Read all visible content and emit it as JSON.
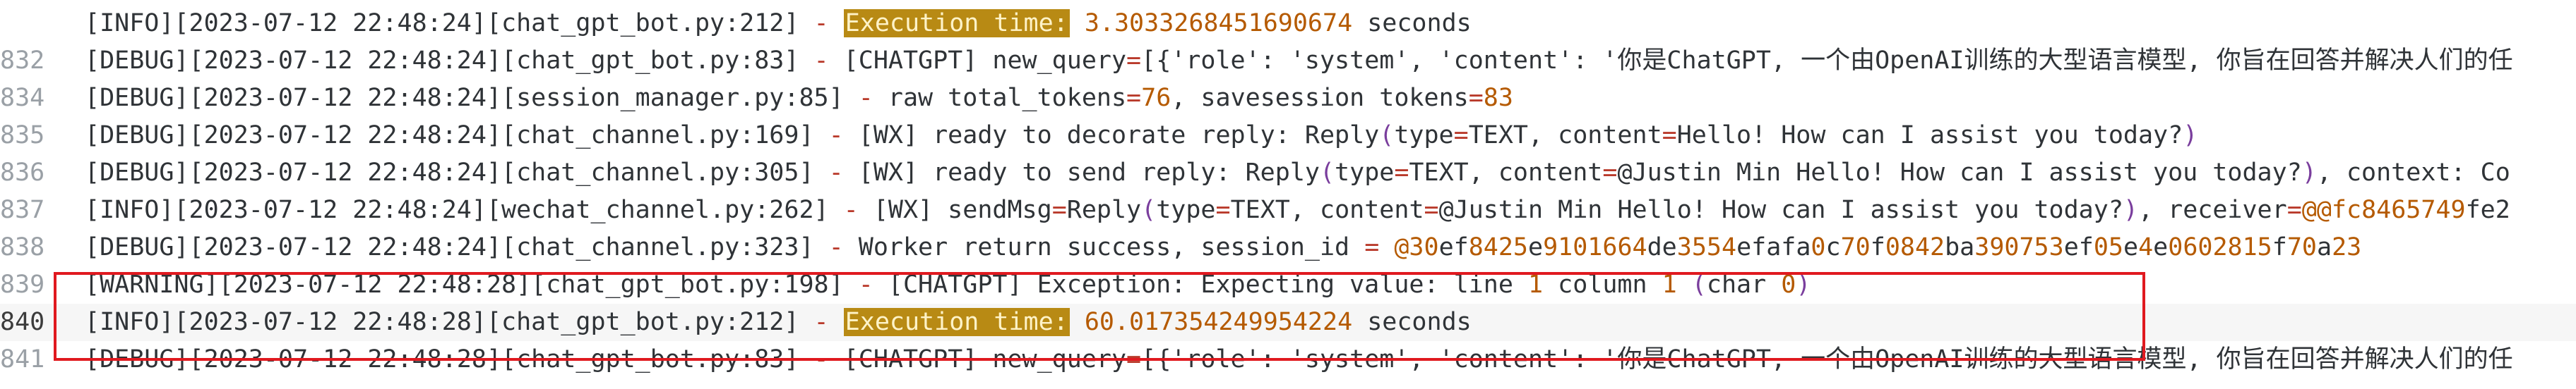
{
  "colors": {
    "background": "#ffffff",
    "text": "#2f3337",
    "line_number": "#9aa0a6",
    "dash": "#b93a2b",
    "number": "#b55a00",
    "highlight_bg": "#b88a14",
    "highlight_fg": "#fff3c8",
    "selection_box": "#e0191f"
  },
  "lines": [
    {
      "num": "",
      "active": false,
      "parts": [
        {
          "t": "[INFO][2023-07-12 22:48:24][chat_gpt_bot.py:212] "
        },
        {
          "t": "-",
          "c": "dash"
        },
        {
          "t": " "
        },
        {
          "t": "Execution time:",
          "c": "hl"
        },
        {
          "t": " "
        },
        {
          "t": "3.3033268451690674",
          "c": "num"
        },
        {
          "t": " seconds"
        }
      ]
    },
    {
      "num": "832",
      "active": false,
      "parts": [
        {
          "t": "[DEBUG][2023-07-12 22:48:24][chat_gpt_bot.py:83] "
        },
        {
          "t": "-",
          "c": "dash"
        },
        {
          "t": " [CHATGPT] new_query"
        },
        {
          "t": "=",
          "c": "eq"
        },
        {
          "t": "[{'role': 'system', 'content': '你是ChatGPT, 一个由OpenAI训练的大型语言模型, 你旨在回答并解决人们的任"
        }
      ]
    },
    {
      "num": "834",
      "active": false,
      "parts": [
        {
          "t": "[DEBUG][2023-07-12 22:48:24][session_manager.py:85] "
        },
        {
          "t": "-",
          "c": "dash"
        },
        {
          "t": " raw total_tokens"
        },
        {
          "t": "=",
          "c": "eq"
        },
        {
          "t": "76",
          "c": "num"
        },
        {
          "t": ", savesession tokens"
        },
        {
          "t": "=",
          "c": "eq"
        },
        {
          "t": "83",
          "c": "num"
        }
      ]
    },
    {
      "num": "835",
      "active": false,
      "parts": [
        {
          "t": "[DEBUG][2023-07-12 22:48:24][chat_channel.py:169] "
        },
        {
          "t": "-",
          "c": "dash"
        },
        {
          "t": " [WX] ready to decorate reply: Reply"
        },
        {
          "t": "(",
          "c": "paren"
        },
        {
          "t": "type"
        },
        {
          "t": "=",
          "c": "eq"
        },
        {
          "t": "TEXT, content"
        },
        {
          "t": "=",
          "c": "eq"
        },
        {
          "t": "Hello! How can I assist you today?"
        },
        {
          "t": ")",
          "c": "paren"
        }
      ]
    },
    {
      "num": "836",
      "active": false,
      "parts": [
        {
          "t": "[DEBUG][2023-07-12 22:48:24][chat_channel.py:305] "
        },
        {
          "t": "-",
          "c": "dash"
        },
        {
          "t": " [WX] ready to send reply: Reply"
        },
        {
          "t": "(",
          "c": "paren"
        },
        {
          "t": "type"
        },
        {
          "t": "=",
          "c": "eq"
        },
        {
          "t": "TEXT, content"
        },
        {
          "t": "=",
          "c": "eq"
        },
        {
          "t": "@Justin Min Hello! How can I assist you today?"
        },
        {
          "t": ")",
          "c": "paren"
        },
        {
          "t": ", context: Co"
        }
      ]
    },
    {
      "num": "837",
      "active": false,
      "parts": [
        {
          "t": "[INFO][2023-07-12 22:48:24][wechat_channel.py:262] "
        },
        {
          "t": "-",
          "c": "dash"
        },
        {
          "t": " [WX] sendMsg"
        },
        {
          "t": "=",
          "c": "eq"
        },
        {
          "t": "Reply"
        },
        {
          "t": "(",
          "c": "paren"
        },
        {
          "t": "type"
        },
        {
          "t": "=",
          "c": "eq"
        },
        {
          "t": "TEXT, content"
        },
        {
          "t": "=",
          "c": "eq"
        },
        {
          "t": "@Justin Min Hello! How can I assist you today?"
        },
        {
          "t": ")",
          "c": "paren"
        },
        {
          "t": ", receiver"
        },
        {
          "t": "=",
          "c": "eq"
        },
        {
          "t": "@@fc",
          "c": "num"
        },
        {
          "t": "8465749",
          "c": "num"
        },
        {
          "t": "fe2"
        }
      ]
    },
    {
      "num": "838",
      "active": false,
      "parts": [
        {
          "t": "[DEBUG][2023-07-12 22:48:24][chat_channel.py:323] "
        },
        {
          "t": "-",
          "c": "dash"
        },
        {
          "t": " Worker return success, session_id "
        },
        {
          "t": "=",
          "c": "eq"
        },
        {
          "t": " "
        },
        {
          "t": "@30",
          "c": "num"
        },
        {
          "t": "ef"
        },
        {
          "t": "8425",
          "c": "num"
        },
        {
          "t": "e"
        },
        {
          "t": "9101664",
          "c": "num"
        },
        {
          "t": "de"
        },
        {
          "t": "3554",
          "c": "num"
        },
        {
          "t": "efafa"
        },
        {
          "t": "0",
          "c": "num"
        },
        {
          "t": "c"
        },
        {
          "t": "70",
          "c": "num"
        },
        {
          "t": "f"
        },
        {
          "t": "0842",
          "c": "num"
        },
        {
          "t": "ba"
        },
        {
          "t": "390753",
          "c": "num"
        },
        {
          "t": "ef"
        },
        {
          "t": "05",
          "c": "num"
        },
        {
          "t": "e"
        },
        {
          "t": "4",
          "c": "num"
        },
        {
          "t": "e"
        },
        {
          "t": "0602815",
          "c": "num"
        },
        {
          "t": "f"
        },
        {
          "t": "70",
          "c": "num"
        },
        {
          "t": "a"
        },
        {
          "t": "23",
          "c": "num"
        }
      ]
    },
    {
      "num": "839",
      "active": false,
      "parts": [
        {
          "t": "[WARNING][2023-07-12 22:48:28][chat_gpt_bot.py:198] "
        },
        {
          "t": "-",
          "c": "dash"
        },
        {
          "t": " [CHATGPT] Exception: Expecting value: line "
        },
        {
          "t": "1",
          "c": "num"
        },
        {
          "t": " column "
        },
        {
          "t": "1",
          "c": "num"
        },
        {
          "t": " "
        },
        {
          "t": "(",
          "c": "paren"
        },
        {
          "t": "char "
        },
        {
          "t": "0",
          "c": "num"
        },
        {
          "t": ")",
          "c": "paren"
        }
      ]
    },
    {
      "num": "840",
      "active": true,
      "parts": [
        {
          "t": "[INFO][2023-07-12 22:48:28][chat_gpt_bot.py:212] "
        },
        {
          "t": "-",
          "c": "dash"
        },
        {
          "t": " "
        },
        {
          "t": "Execution time:",
          "c": "hl"
        },
        {
          "t": " "
        },
        {
          "t": "60.017354249954224",
          "c": "num"
        },
        {
          "t": " seconds"
        }
      ]
    },
    {
      "num": "841",
      "active": false,
      "parts": [
        {
          "t": "[DEBUG][2023-07-12 22:48:28][chat_gpt_bot.py:83] "
        },
        {
          "t": "-",
          "c": "dash"
        },
        {
          "t": " [CHATGPT] new_query"
        },
        {
          "t": "=",
          "c": "eq"
        },
        {
          "t": "[{'role': 'system', 'content': '你是ChatGPT, 一个由OpenAI训练的大型语言模型, 你旨在回答并解决人们的任"
        }
      ]
    }
  ]
}
